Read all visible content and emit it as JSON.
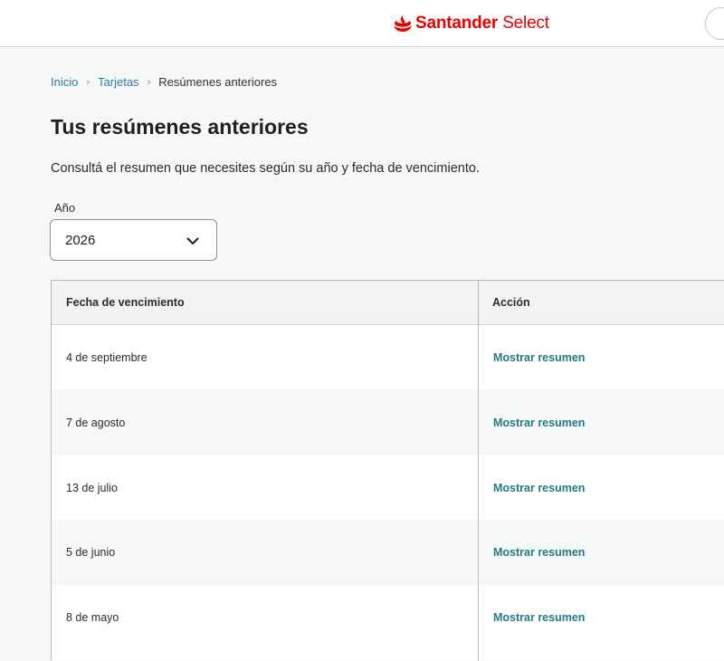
{
  "header": {
    "brand_strong": "Santander",
    "brand_light": " Select",
    "brand_color": "#ec0000"
  },
  "breadcrumb": {
    "items": [
      "Inicio",
      "Tarjetas",
      "Resúmenes anteriores"
    ],
    "separator": "›"
  },
  "page": {
    "title": "Tus resúmenes anteriores",
    "subtitle": "Consultá el resumen que necesites según su año y fecha de vencimiento."
  },
  "year_filter": {
    "label": "Año",
    "selected": "2026",
    "icon": "chevron-down-icon"
  },
  "table": {
    "columns": [
      "Fecha de vencimiento",
      "Acción"
    ],
    "rows": [
      {
        "date": "4 de septiembre",
        "action": "Mostrar resumen"
      },
      {
        "date": "7 de agosto",
        "action": "Mostrar resumen"
      },
      {
        "date": "13 de julio",
        "action": "Mostrar resumen"
      },
      {
        "date": "5 de junio",
        "action": "Mostrar resumen"
      },
      {
        "date": "8 de mayo",
        "action": "Mostrar resumen"
      }
    ]
  },
  "colors": {
    "link": "#257fa4",
    "action": "#257a84",
    "row_alt": "#f6f7f7"
  }
}
